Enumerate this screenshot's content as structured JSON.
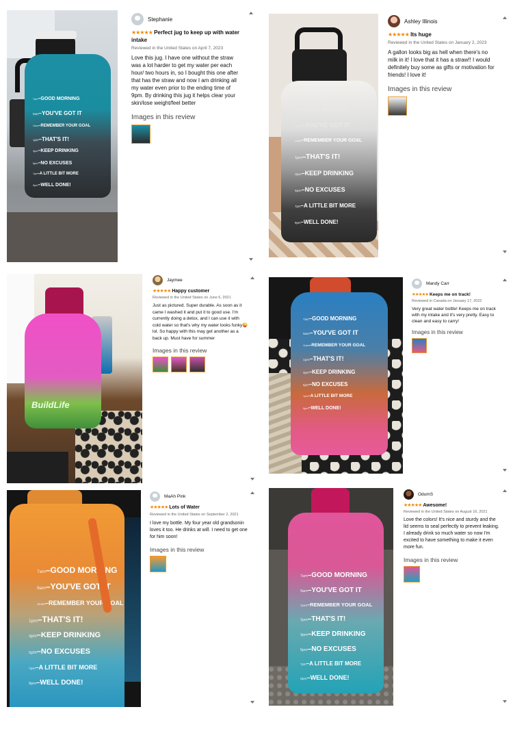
{
  "reviews": [
    {
      "name": "Stephanie",
      "stars": "★★★★★",
      "title": "Perfect jug to keep up with water intake",
      "meta": "Reviewed in the United States on April 7, 2023",
      "body": "Love this jug. I have one without the straw was a lot harder to get my water per each hour/ two hours in, so I bought this one after that has the straw and now I am drinking all my water even prior to the ending time of 9pm. By drinking this jug it helps clear your skin/lose weight/feel better",
      "images_label": "Images in this review"
    },
    {
      "name": "Ashley Illinois",
      "stars": "★★★★★",
      "title": "Its huge",
      "meta": "Reviewed in the United States on January 2, 2023",
      "body": "A gallon looks big as hell when there's no milk in it! I love that it has a straw!! I would definitely buy some as gifts or motivation for friends! I love it!",
      "images_label": "Images in this review"
    },
    {
      "name": "Jaymee",
      "stars": "★★★★★",
      "title": "Happy customer",
      "meta": "Reviewed in the United States on June 6, 2021",
      "body": "Just as pictured. Super durable. As soon as it came I washed it and put it to good use. I'm currently doing a detox, and I can use it with cold water so that's why my water looks funky😜 lol. So happy with this may get another as a back up. Must have for summer",
      "images_label": "Images in this review"
    },
    {
      "name": "Mandy Carr",
      "stars": "★★★★★",
      "title": "Keeps me on track!",
      "meta": "Reviewed in Canada on January 17, 2022",
      "body": "Very great water bottle! Keeps me on track with my intake and it's very pretty. Easy to clean and easy to carry!",
      "images_label": "Images in this review"
    },
    {
      "name": "MaAh Pink",
      "stars": "★★★★★",
      "title": "Lots of Water",
      "meta": "Reviewed in the United States on September 2, 2021",
      "body": "I love my bottle. My four year old grandsonin loves it too. He drinks at will. I need to get one for him soon!",
      "images_label": "Images in this review"
    },
    {
      "name": "OdumS",
      "stars": "★★★★★",
      "title": "Awesome!",
      "meta": "Reviewed in the United States on August 16, 2021",
      "body": "Love the colors! It's nice and sturdy and the lid seems to seal perfectly to prevent leaking. I already drink so much water so now I'm excited to have something to make it even more fun.",
      "images_label": "Images in this review"
    }
  ],
  "bottle_lines": [
    {
      "time": "7am",
      "text": "GOOD MORNING"
    },
    {
      "time": "9am",
      "text": "YOU'VE GOT IT"
    },
    {
      "time": "11am",
      "text": "REMEMBER YOUR GOAL"
    },
    {
      "time": "1pm",
      "text": "THAT'S IT!"
    },
    {
      "time": "3pm",
      "text": "KEEP DRINKING"
    },
    {
      "time": "5pm",
      "text": "NO EXCUSES"
    },
    {
      "time": "7pm",
      "text": "A LITTLE BIT MORE"
    },
    {
      "time": "9pm",
      "text": "WELL DONE!"
    }
  ],
  "bottle_brand_text": "BuildLife",
  "colors": {
    "star": "#f08804",
    "thumb_border": "#e89a2c"
  },
  "icons": {
    "avatar": "user-avatar-icon",
    "scroll_up": "scroll-up-arrow-icon",
    "scroll_down": "scroll-down-arrow-icon"
  }
}
